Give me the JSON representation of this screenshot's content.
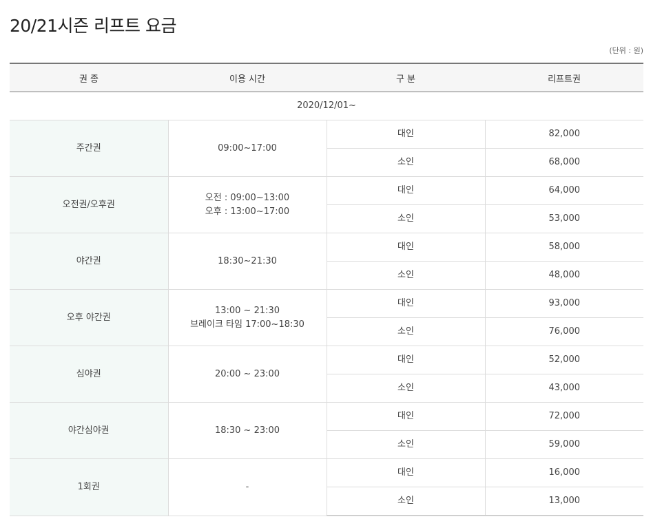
{
  "page": {
    "title": "20/21시즌 리프트 요금",
    "unit_note": "(단위 : 원)"
  },
  "table": {
    "headers": [
      "권 종",
      "이용 시간",
      "구 분",
      "리프트권"
    ],
    "period": "2020/12/01~",
    "rows": [
      {
        "type": "주간권",
        "time": [
          "09:00~17:00"
        ],
        "prices": [
          {
            "category": "대인",
            "price": "82,000"
          },
          {
            "category": "소인",
            "price": "68,000"
          }
        ]
      },
      {
        "type": "오전권/오후권",
        "time": [
          "오전 : 09:00~13:00",
          "오후 : 13:00~17:00"
        ],
        "prices": [
          {
            "category": "대인",
            "price": "64,000"
          },
          {
            "category": "소인",
            "price": "53,000"
          }
        ]
      },
      {
        "type": "야간권",
        "time": [
          "18:30~21:30"
        ],
        "prices": [
          {
            "category": "대인",
            "price": "58,000"
          },
          {
            "category": "소인",
            "price": "48,000"
          }
        ]
      },
      {
        "type": "오후 야간권",
        "time": [
          "13:00 ~ 21:30",
          "브레이크 타임 17:00~18:30"
        ],
        "prices": [
          {
            "category": "대인",
            "price": "93,000"
          },
          {
            "category": "소인",
            "price": "76,000"
          }
        ]
      },
      {
        "type": "심야권",
        "time": [
          "20:00 ~ 23:00"
        ],
        "prices": [
          {
            "category": "대인",
            "price": "52,000"
          },
          {
            "category": "소인",
            "price": "43,000"
          }
        ]
      },
      {
        "type": "야간심야권",
        "time": [
          "18:30 ~ 23:00"
        ],
        "prices": [
          {
            "category": "대인",
            "price": "72,000"
          },
          {
            "category": "소인",
            "price": "59,000"
          }
        ]
      },
      {
        "type": "1회권",
        "time": [
          "-"
        ],
        "prices": [
          {
            "category": "대인",
            "price": "16,000"
          },
          {
            "category": "소인",
            "price": "13,000"
          }
        ]
      }
    ]
  }
}
